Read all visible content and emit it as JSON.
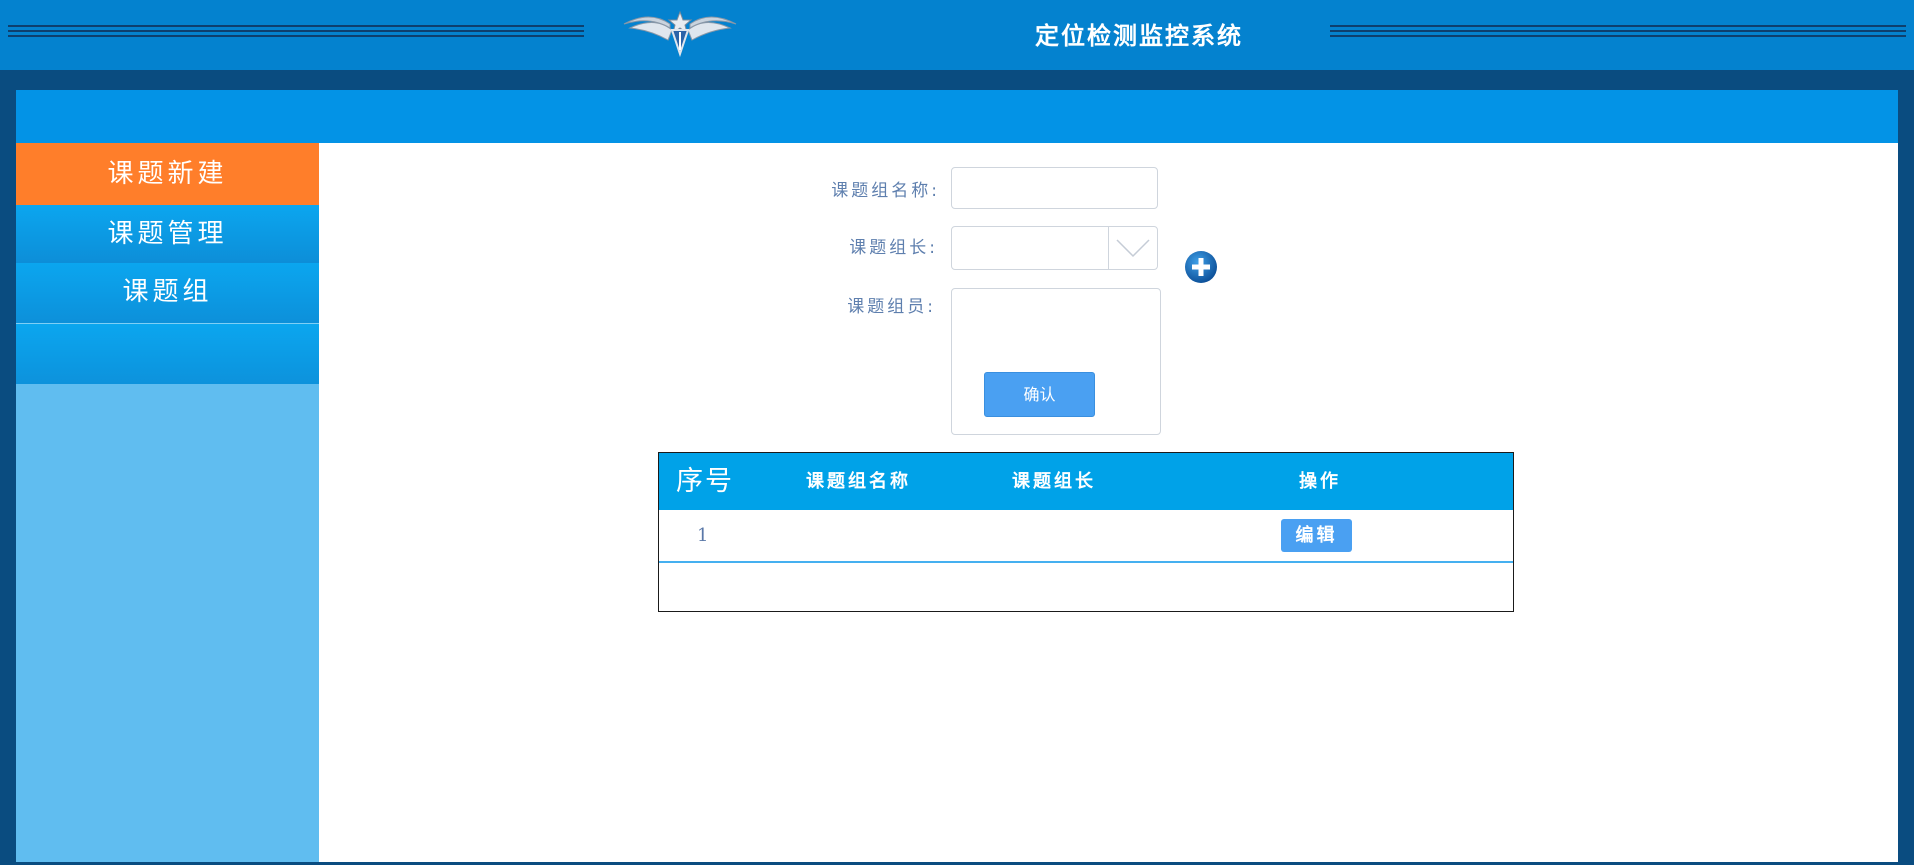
{
  "header": {
    "title": "定位检测监控系统",
    "logo_icon": "winged-star-emblem-icon"
  },
  "sidebar": {
    "items": [
      {
        "label": "课题新建",
        "active": true
      },
      {
        "label": "课题管理",
        "active": false
      },
      {
        "label": "课题组",
        "active": false
      }
    ]
  },
  "form": {
    "group_name_label": "课题组名称:",
    "group_name_value": "",
    "leader_label": "课题组长:",
    "leader_value": "",
    "members_label": "课题组员:",
    "members_value": "",
    "add_icon": "plus-circle-icon",
    "confirm_label": "确认"
  },
  "table": {
    "headers": [
      "序号",
      "课题组名称",
      "课题组长",
      "操作"
    ],
    "rows": [
      {
        "no": "1",
        "name": "",
        "leader": "",
        "action": "编辑"
      }
    ]
  },
  "colors": {
    "header_blue": "#0482cf",
    "subheader_blue": "#0393e6",
    "active_orange": "#ff7e2a",
    "sidebar_light": "#60bdf0",
    "table_header": "#00a2e8",
    "button_blue": "#4aa0f2",
    "frame_dark": "#0a4c80"
  }
}
